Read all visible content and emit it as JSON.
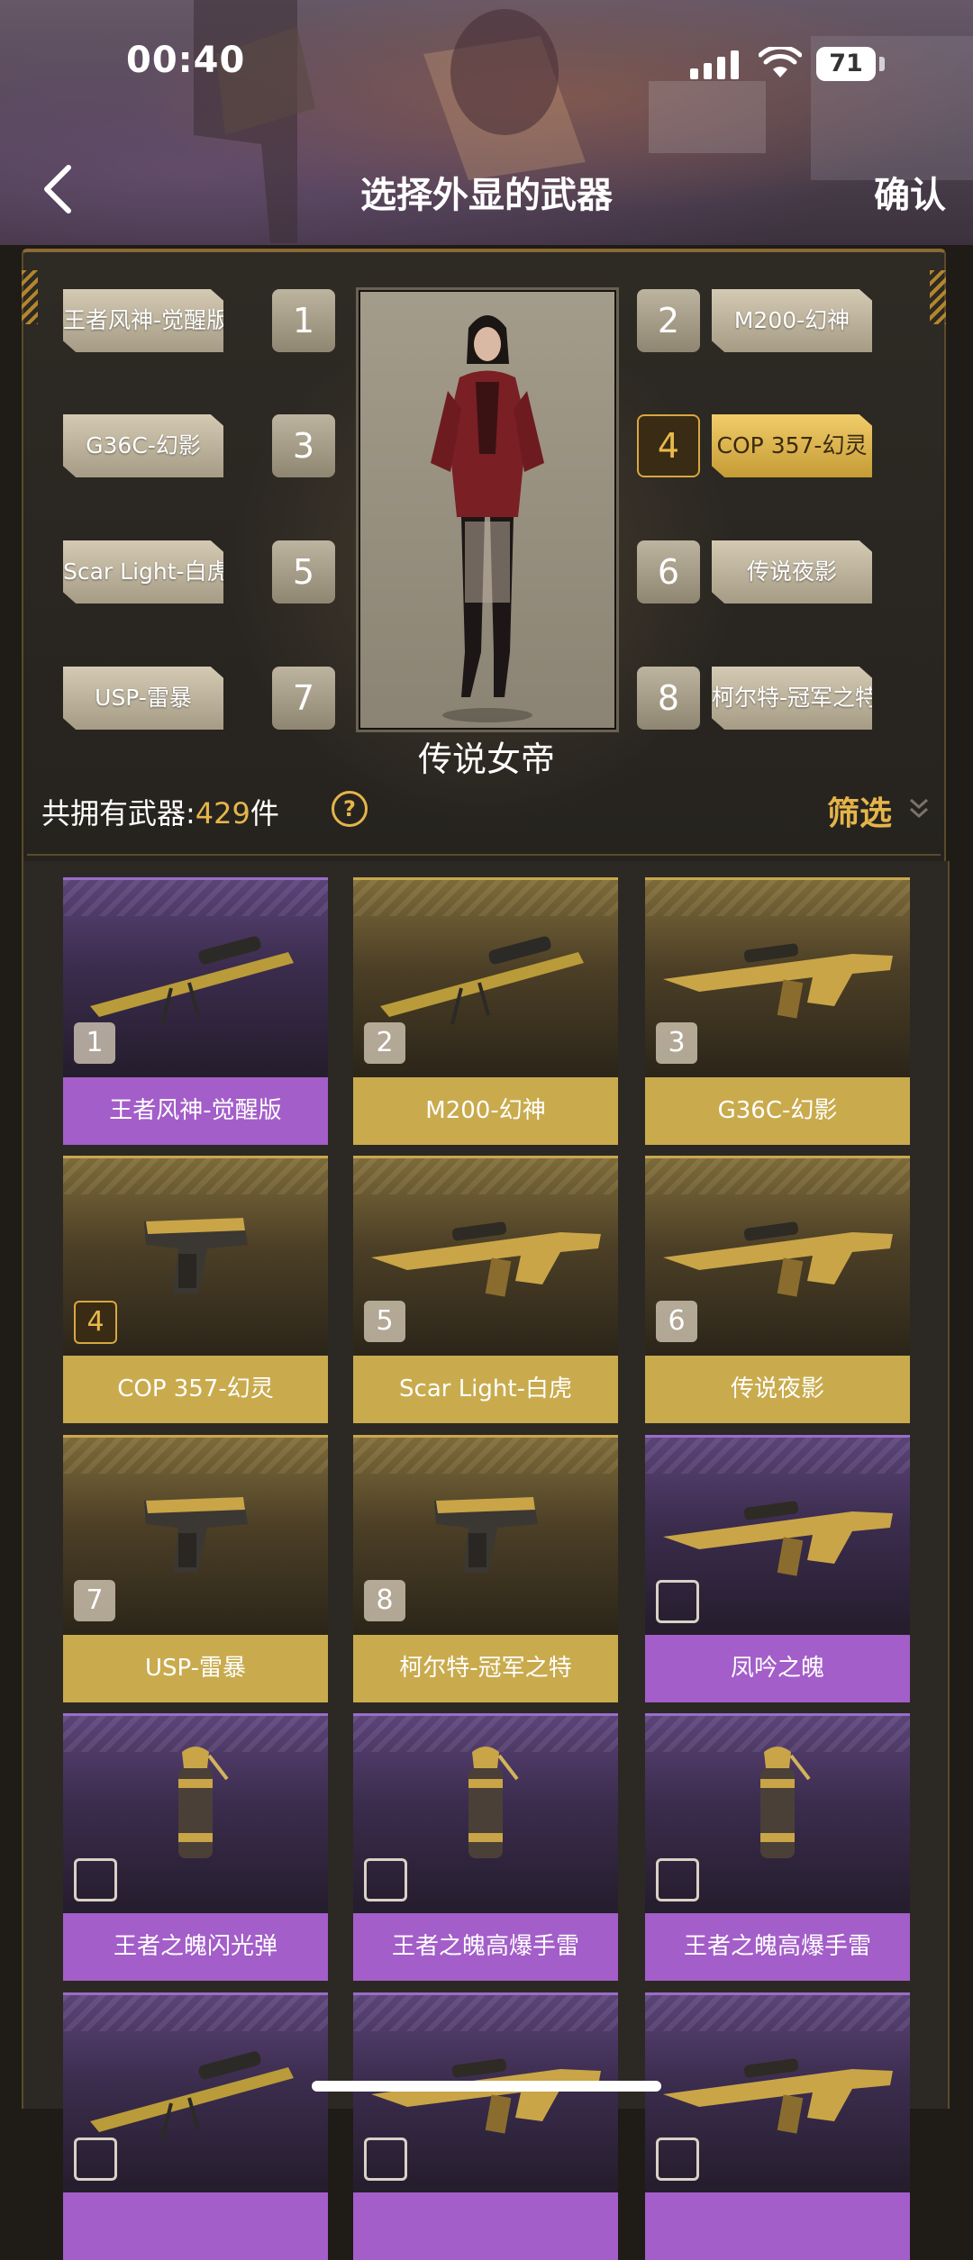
{
  "status": {
    "time": "00:40",
    "battery": "71"
  },
  "header": {
    "title": "选择外显的武器",
    "confirm": "确认"
  },
  "slots": [
    {
      "num": "1",
      "label": "王者风神-觉醒版",
      "selected": false
    },
    {
      "num": "2",
      "label": "M200-幻神",
      "selected": false
    },
    {
      "num": "3",
      "label": "G36C-幻影",
      "selected": false
    },
    {
      "num": "4",
      "label": "COP 357-幻灵",
      "selected": true
    },
    {
      "num": "5",
      "label": "Scar Light-白虎",
      "selected": false
    },
    {
      "num": "6",
      "label": "传说夜影",
      "selected": false
    },
    {
      "num": "7",
      "label": "USP-雷暴",
      "selected": false
    },
    {
      "num": "8",
      "label": "柯尔特-冠军之特",
      "selected": false
    }
  ],
  "character": {
    "name": "传说女帝"
  },
  "inventory": {
    "prefix": "共拥有武器:",
    "count": "429",
    "unit": "件",
    "help": "?",
    "filter": "筛选"
  },
  "weapons": [
    {
      "name": "王者风神-觉醒版",
      "badge": "1",
      "rarity": "purple",
      "icon": "sniper-rifle-icon",
      "selected": false
    },
    {
      "name": "M200-幻神",
      "badge": "2",
      "rarity": "gold",
      "icon": "sniper-rifle-icon",
      "selected": false
    },
    {
      "name": "G36C-幻影",
      "badge": "3",
      "rarity": "gold",
      "icon": "assault-rifle-icon",
      "selected": false
    },
    {
      "name": "COP 357-幻灵",
      "badge": "4",
      "rarity": "gold",
      "icon": "pistol-icon",
      "selected": true
    },
    {
      "name": "Scar Light-白虎",
      "badge": "5",
      "rarity": "gold",
      "icon": "assault-rifle-icon",
      "selected": false
    },
    {
      "name": "传说夜影",
      "badge": "6",
      "rarity": "gold",
      "icon": "assault-rifle-icon",
      "selected": false
    },
    {
      "name": "USP-雷暴",
      "badge": "7",
      "rarity": "gold",
      "icon": "pistol-icon",
      "selected": false
    },
    {
      "name": "柯尔特-冠军之特",
      "badge": "8",
      "rarity": "gold",
      "icon": "pistol-icon",
      "selected": false
    },
    {
      "name": "凤吟之魄",
      "badge": "",
      "rarity": "purple",
      "icon": "assault-rifle-icon",
      "selected": false
    },
    {
      "name": "王者之魄闪光弹",
      "badge": "",
      "rarity": "purple",
      "icon": "grenade-icon",
      "selected": false
    },
    {
      "name": "王者之魄高爆手雷",
      "badge": "",
      "rarity": "purple",
      "icon": "grenade-icon",
      "selected": false
    },
    {
      "name": "王者之魄高爆手雷",
      "badge": "",
      "rarity": "purple",
      "icon": "grenade-icon",
      "selected": false
    },
    {
      "name": "",
      "badge": "",
      "rarity": "purple",
      "icon": "sniper-rifle-icon",
      "selected": false
    },
    {
      "name": "",
      "badge": "",
      "rarity": "purple",
      "icon": "assault-rifle-icon",
      "selected": false
    },
    {
      "name": "",
      "badge": "",
      "rarity": "purple",
      "icon": "assault-rifle-icon",
      "selected": false
    }
  ],
  "colors": {
    "gold": "#c9ab4e",
    "purple": "#a35ec9",
    "accent": "#e5b54a"
  }
}
